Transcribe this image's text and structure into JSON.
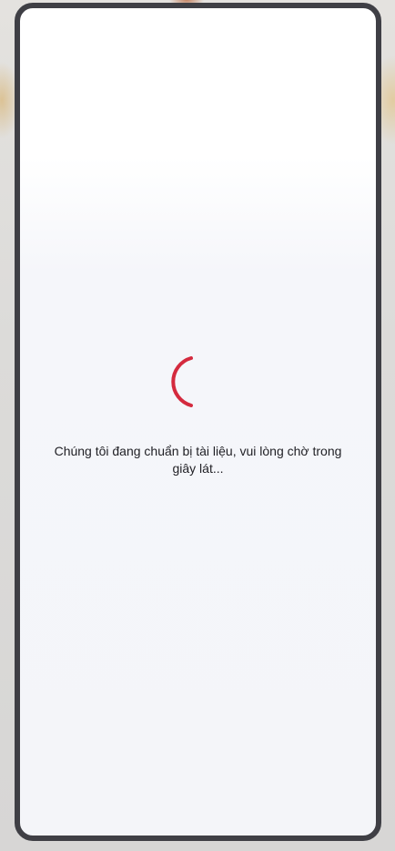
{
  "loader": {
    "spinner_icon": "loading-spinner-icon",
    "spinner_color": "#d42a3e",
    "message": "Chúng tôi đang chuẩn bị tài liệu, vui lòng chờ trong giây lát..."
  },
  "colors": {
    "frame_border": "#3f3f45",
    "screen_background": "#f4f5f9",
    "text": "#1f1f24"
  }
}
